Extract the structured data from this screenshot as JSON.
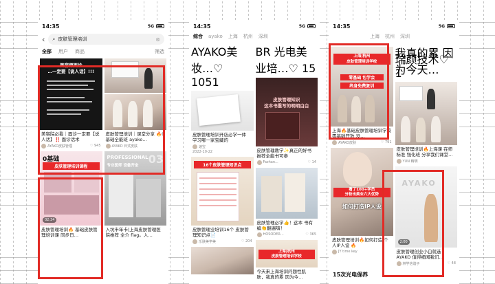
{
  "phone1": {
    "status": {
      "time": "14:35",
      "signal": "5G"
    },
    "search": {
      "query": "皮肤管理培训"
    },
    "filters": [
      "全部",
      "用户",
      "商品",
      "筛选"
    ],
    "cards": [
      {
        "overlay": "美容师面诊\n…一定要【说人话】!!!",
        "title": "美容院必看｜面诊一定要【说人话】‼️ 面诊话术",
        "author": "AYAKO皮肤管理",
        "likes": "945"
      },
      {
        "title": "皮肤管理培训｜课堂分享 🔥0基础全能班 ayako…",
        "author": "AYAKO 日式皮肤",
        "likes": ""
      },
      {
        "overlay_top": "0基础",
        "overlay_sub": "皮肤管理培训课程",
        "title": "皮肤管理培训🔥 基础皮肤管理培训课 同步日…",
        "duration": "02:34"
      },
      {
        "overlay_top": "PROFESSIONAL",
        "overlay_sub": "专业医师 设备齐全",
        "title": "入坑半年卡|上海皮肤管理医院推荐 全介 flag。入…",
        "big": "03"
      }
    ]
  },
  "phone2": {
    "status": {
      "time": "14:35",
      "signal": "5G"
    },
    "tabs": [
      "综合",
      "ayako",
      "上海",
      "杭州",
      "深圳"
    ],
    "top_meta": [
      {
        "author": "AYAKO美妆…",
        "likes": "1051"
      },
      {
        "author": "BR 光电美业培…",
        "likes": "15"
      }
    ],
    "cards": [
      {
        "title": "皮肤管理培训开店必学一体 学习哪一家宝藏的",
        "author": "速宝",
        "date": "2022-10-22"
      },
      {
        "overlay": "皮肤管理知识\n这本书重写的明明白白",
        "title": "皮肤管理教学✨真正的好书 推荐全能书可参",
        "author": "Fazhan...",
        "likes": "14"
      },
      {
        "overlay": "16个皮肤管理知识点",
        "title": "皮肤管理必学👍！这本 书有编👏翻遍嗨！",
        "author": "HOSODER…",
        "likes": "365"
      },
      {
        "title": "皮肤管理业培训16个 皮肤管理知识点📄",
        "author": "乐肤美学美",
        "likes": "204"
      },
      {
        "overlay": "上海|杭州\n皮肤管理培训学校",
        "title": "今天来上海培训问题性肌 肤，我真的累 因为今…",
        "author": "润明美容学员",
        "likes": ""
      }
    ]
  },
  "phone3": {
    "status": {
      "time": "14:35",
      "signal": "5G"
    },
    "tabs": [
      "上海",
      "杭州",
      "深圳"
    ],
    "top_text": "我真的累 因为今天…",
    "top_author": "瑞颜技术",
    "top_likes": "1",
    "cards": [
      {
        "overlay": "上海|杭州\n皮肤管理培训学校",
        "tag1": "零基础 包学会",
        "tag2": "终身免费复训",
        "title": "上海🔥基础皮肤管理培训学校 零基础开放 没…",
        "author": "AYAKO皮肤",
        "likes": "791"
      },
      {
        "title": "皮肤管理培训🔥上海课 在师标准 强化班 分享我们课堂…",
        "author": "YUN 精明",
        "likes": ""
      },
      {
        "overlay": "看了100+学员\n分析出美业六大优势",
        "title": "皮肤管理培训🔥如何打造 个人IP人设 🔥",
        "overlay_big": "如何打造IP人设",
        "author": "JY time key",
        "likes": ""
      },
      {
        "brand": "AYAKO",
        "title": "皮肤管理创业小白就选 AYAKO 值得细闻我们…",
        "author": "林学信谐子",
        "likes": "48",
        "duration": "2:00"
      }
    ],
    "bottom_text": "15次光电保养"
  }
}
